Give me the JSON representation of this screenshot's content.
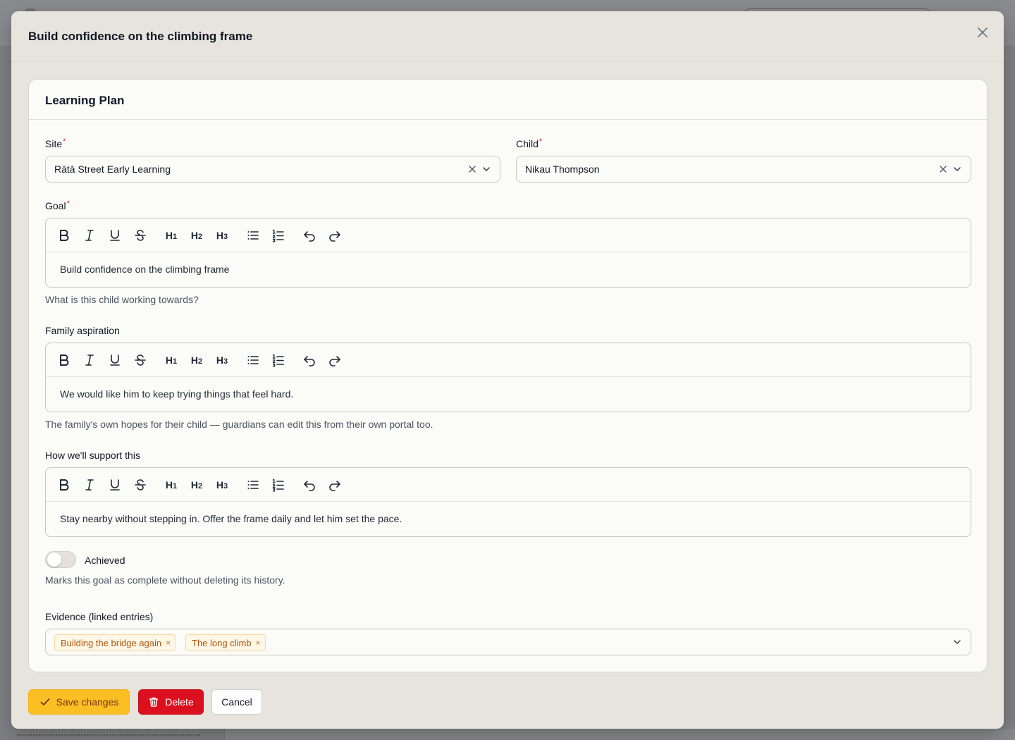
{
  "modal": {
    "title": "Build confidence on the climbing frame"
  },
  "section": {
    "title": "Learning Plan"
  },
  "fields": {
    "site": {
      "label": "Site",
      "required_mark": "*",
      "value": "Rātā Street Early Learning"
    },
    "child": {
      "label": "Child",
      "required_mark": "*",
      "value": "Nikau Thompson"
    },
    "goal": {
      "label": "Goal",
      "required_mark": "*",
      "content": "Build confidence on the climbing frame",
      "help": "What is this child working towards?"
    },
    "family_aspiration": {
      "label": "Family aspiration",
      "content": "We would like him to keep trying things that feel hard.",
      "help": "The family's own hopes for their child — guardians can edit this from their own portal too."
    },
    "support": {
      "label": "How we'll support this",
      "content": "Stay nearby without stepping in. Offer the frame daily and let him set the pace."
    },
    "achieved": {
      "label": "Achieved",
      "checked": false,
      "help": "Marks this goal as complete without deleting its history."
    },
    "evidence": {
      "label": "Evidence (linked entries)",
      "tags": [
        "Building the bridge again",
        "The long climb"
      ]
    }
  },
  "toolbar_icons": [
    "bold-icon",
    "italic-icon",
    "underline-icon",
    "strikethrough-icon",
    "heading-1-icon",
    "heading-2-icon",
    "heading-3-icon",
    "bullet-list-icon",
    "ordered-list-icon",
    "undo-icon",
    "redo-icon"
  ],
  "toolbar_heading_labels": {
    "h1": "H1",
    "h2": "H2",
    "h3": "H3"
  },
  "footer": {
    "save_label": "Save changes",
    "delete_label": "Delete",
    "cancel_label": "Cancel"
  },
  "colors": {
    "accent": "#fbbf24",
    "danger": "#dc0f1e",
    "required": "#dc2626",
    "tag_text": "#b45309"
  }
}
